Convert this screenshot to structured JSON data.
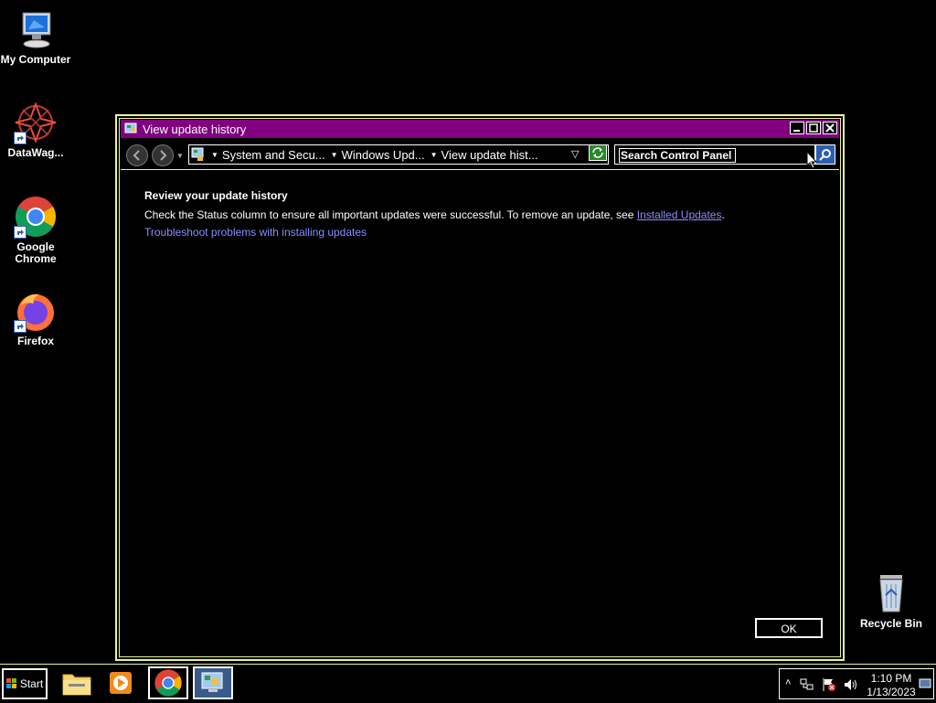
{
  "desktop": {
    "icons": [
      {
        "label": "My Computer"
      },
      {
        "label": "DataWag..."
      },
      {
        "label": "Google Chrome"
      },
      {
        "label": "Firefox"
      },
      {
        "label": "Recycle Bin"
      }
    ]
  },
  "window": {
    "title": "View update history",
    "breadcrumbs": [
      "System and Secu...",
      "Windows Upd...",
      "View update hist..."
    ],
    "search": {
      "placeholder": "Search Control Panel",
      "value": "Search Control Panel"
    },
    "heading": "Review your update history",
    "description": "Check the Status column to ensure all important updates were successful. To remove an update, see",
    "installed_updates_link": "Installed Updates",
    "period": ".",
    "troubleshoot_link": "Troubleshoot problems with installing updates",
    "ok_label": "OK"
  },
  "taskbar": {
    "start_label": "Start",
    "clock_time": "1:10 PM",
    "clock_date": "1/13/2023"
  },
  "colors": {
    "titlebar": "#800080",
    "border": "#e9f2a0",
    "link": "#8b8bff"
  }
}
